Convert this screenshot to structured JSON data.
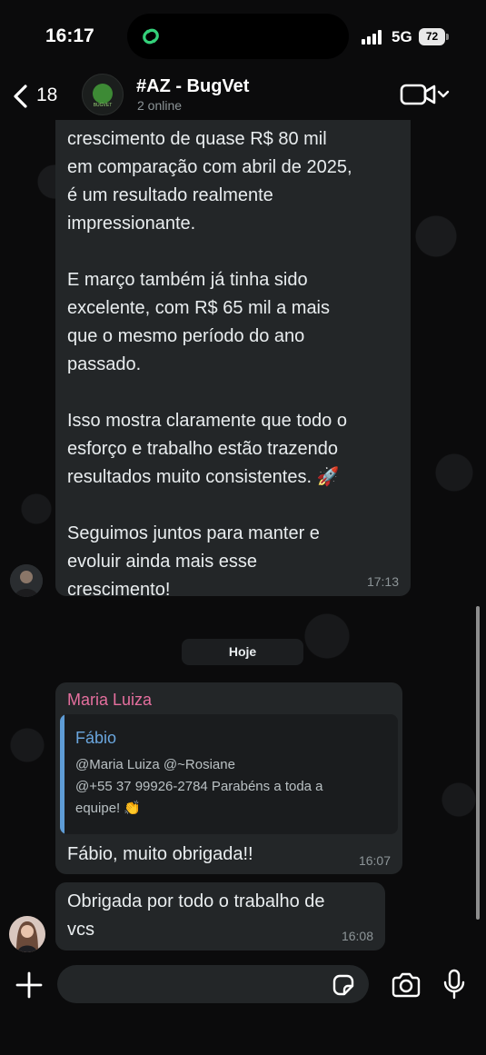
{
  "status_bar": {
    "time": "16:17",
    "network": "5G",
    "battery": "72"
  },
  "header": {
    "back_count": "18",
    "title": "#AZ - BugVet",
    "subtitle": "2 online",
    "avatar_text": "BUGVET"
  },
  "messages": [
    {
      "text": "crescimento de quase R$ 80 mil\nem comparação com abril de 2025,\né um resultado realmente\nimpressionante.\n\nE março também já tinha sido\nexcelente, com R$ 65 mil a mais\nque o mesmo período do ano\npassado.\n\nIsso mostra claramente que todo o\nesforço e trabalho estão trazendo\nresultados muito consistentes. 🚀\n\nSeguimos juntos para manter e\nevoluir ainda mais esse\ncrescimento!",
      "time": "17:13"
    },
    {
      "sender": "Maria Luiza",
      "quote_author": "Fábio",
      "quote_text": "@Maria Luiza @~Rosiane\n@+55 37 99926-2784 Parabéns a toda a\nequipe! 👏",
      "text": "Fábio, muito obrigada!!",
      "time": "16:07"
    },
    {
      "text": "Obrigada por todo o trabalho de\nvcs",
      "time": "16:08"
    }
  ],
  "date_divider": "Hoje",
  "composer": {
    "placeholder": ""
  },
  "colors": {
    "sender_name": "#e56f9e",
    "quote_accent": "#5e9cd6",
    "bubble": "#232628"
  },
  "icons": [
    "back-chevron-icon",
    "video-call-icon",
    "plus-icon",
    "sticker-icon",
    "camera-icon",
    "microphone-icon"
  ]
}
